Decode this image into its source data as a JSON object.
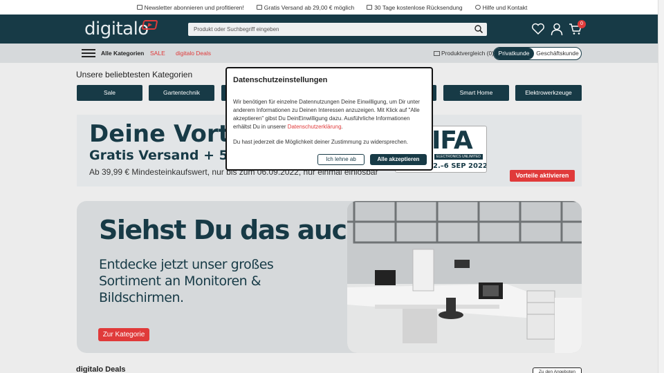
{
  "topbar": {
    "items": [
      {
        "label": "Newsletter abonnieren und profitieren!",
        "icon": "mail-icon"
      },
      {
        "label": "Gratis Versand ab 29,00 € möglich",
        "icon": "truck-icon"
      },
      {
        "label": "30 Tage kostenlose Rücksendung",
        "icon": "return-box-icon"
      },
      {
        "label": "Hilfe und Kontakt",
        "icon": "help-icon"
      }
    ]
  },
  "header": {
    "logo": "digitalo",
    "search_placeholder": "Produkt oder Suchbegriff eingeben",
    "cart_count": "0",
    "colors": {
      "brand": "#173a46",
      "accent": "#e03a3a"
    }
  },
  "nav": {
    "all_categories": "Alle Kategorien",
    "sale": "SALE",
    "deals": "digitalo Deals",
    "compare": "Produktvergleich (0)",
    "customer_types": [
      "Privatkunde",
      "Geschäftskunde"
    ],
    "active_customer_type": "Privatkunde"
  },
  "categories": {
    "title": "Unsere beliebtesten Kategorien",
    "items": [
      "Sale",
      "Gartentechnik",
      "",
      "",
      "",
      "Smart Home",
      "Elektrowerkzeuge"
    ]
  },
  "promo": {
    "headline": "Deine Vorteile",
    "subheadline": "Gratis Versand + 5,55 €",
    "text": "Ab 39,99 € Mindesteinkaufswert, nur bis zum 06.09.2022, nur einmal einlösbar",
    "ifa_logo": "IFA",
    "ifa_sub": "ELECTRONICS UNLIMITED",
    "ifa_date": "2.–6 SEP 2022",
    "cta": "Vorteile aktivieren"
  },
  "hero": {
    "headline": "Siehst Du das auch?",
    "text": "Entdecke jetzt unser großes Sortiment an Monitoren & Bildschirmen.",
    "cta": "Zur Kategorie"
  },
  "deals": {
    "title": "digitalo Deals",
    "button": "Zu den Angeboten"
  },
  "modal": {
    "title": "Datenschutzeinstellungen",
    "body_before_link": "Wir benötigen für einzelne Datennutzungen Deine Einwilligung, um Dir unter anderem Informationen zu Deinen Interessen anzuzeigen. Mit Klick auf \"Alle akzeptieren\" gibst Du DeinEinwilligung dazu. Ausführliche Informationen erhältst Du in unserer ",
    "link": "Datenschutzerklärung",
    "body_after_link": ".",
    "note": "Du hast jederzeit die Möglichkeit deiner Zustimmung zu widersprechen.",
    "reject": "Ich lehne ab",
    "accept": "Alle akzeptieren"
  }
}
